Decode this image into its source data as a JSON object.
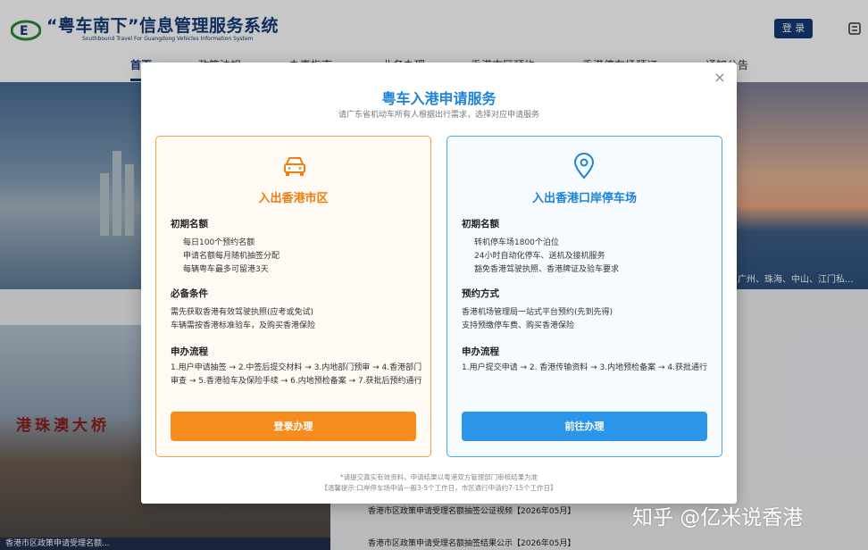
{
  "site": {
    "title": "“粤车南下”信息管理服务系统",
    "subtitle": "Southbound Travel For Guangdong Vehicles Information System",
    "login": "登 录"
  },
  "nav": [
    "首页",
    "政策法规",
    "办事指南",
    "业务办理",
    "香港市区预约",
    "香港停车场预订",
    "通知公告"
  ],
  "banner_caption": "广州、珠海、中山、江门私...",
  "gate_sign": "港珠澳大桥",
  "photo_caption": "香港市区政策申请受理名额...",
  "news": [
    "香港市区政策申请受理名额抽签公证视频【2026年05月】",
    "香港市区政策申请受理名额抽签结果公示【2026年05月】"
  ],
  "watermark": "知乎 @亿米说香港",
  "modal": {
    "title": "粤车入港申请服务",
    "subtitle": "请广东省机动车所有人根据出行需求，选择对应申请服务",
    "close": "×",
    "card_a": {
      "title": "入出香港市区",
      "sec1": "初期名额",
      "quota": [
        "每日100个预约名额",
        "申请名额每月随机抽签分配",
        "每辆粤车最多可留港3天"
      ],
      "sec2": "必备条件",
      "requirements": [
        "需先获取香港有效驾驶执照(应考或免试)",
        "车辆需按香港标准验车，及购买香港保险"
      ],
      "sec3": "申办流程",
      "process": "1.用户申请抽签 → 2.中签后提交材料 → 3.内地部门预审 → 4.香港部门审查 → 5.香港验车及保险手续 → 6.内地预检备案 → 7.获批后预约通行",
      "button": "登录办理"
    },
    "card_b": {
      "title": "入出香港口岸停车场",
      "sec1": "初期名额",
      "quota": [
        "转机停车场1800个泊位",
        "24小时自动化停车、送机及接机服务",
        "豁免香港驾驶执照、香港牌证及验车要求"
      ],
      "sec2": "预约方式",
      "booking": [
        "香港机场管理局一站式平台预约(先到先得)",
        "支持预缴停车费、购买香港保险"
      ],
      "sec3": "申办流程",
      "process": "1.用户提交申请 → 2. 香港传输资料 → 3.内地预检备案 → 4.获批通行",
      "button": "前往办理"
    },
    "footnote1": "*请提交真实有效资料，申请结果以粤港双方管理部门审核结果为准",
    "footnote2": "【温馨提示:口岸停车场申请一般3-5个工作日，市区通行申请约7-15个工作日】"
  },
  "colors": {
    "orange": "#f68b1e",
    "blue": "#2b95ea",
    "brand": "#123a78"
  },
  "icons": {
    "card_a": "car-icon",
    "card_b": "location-pin-icon",
    "logo": "logo-mark",
    "menu": "menu-icon"
  }
}
